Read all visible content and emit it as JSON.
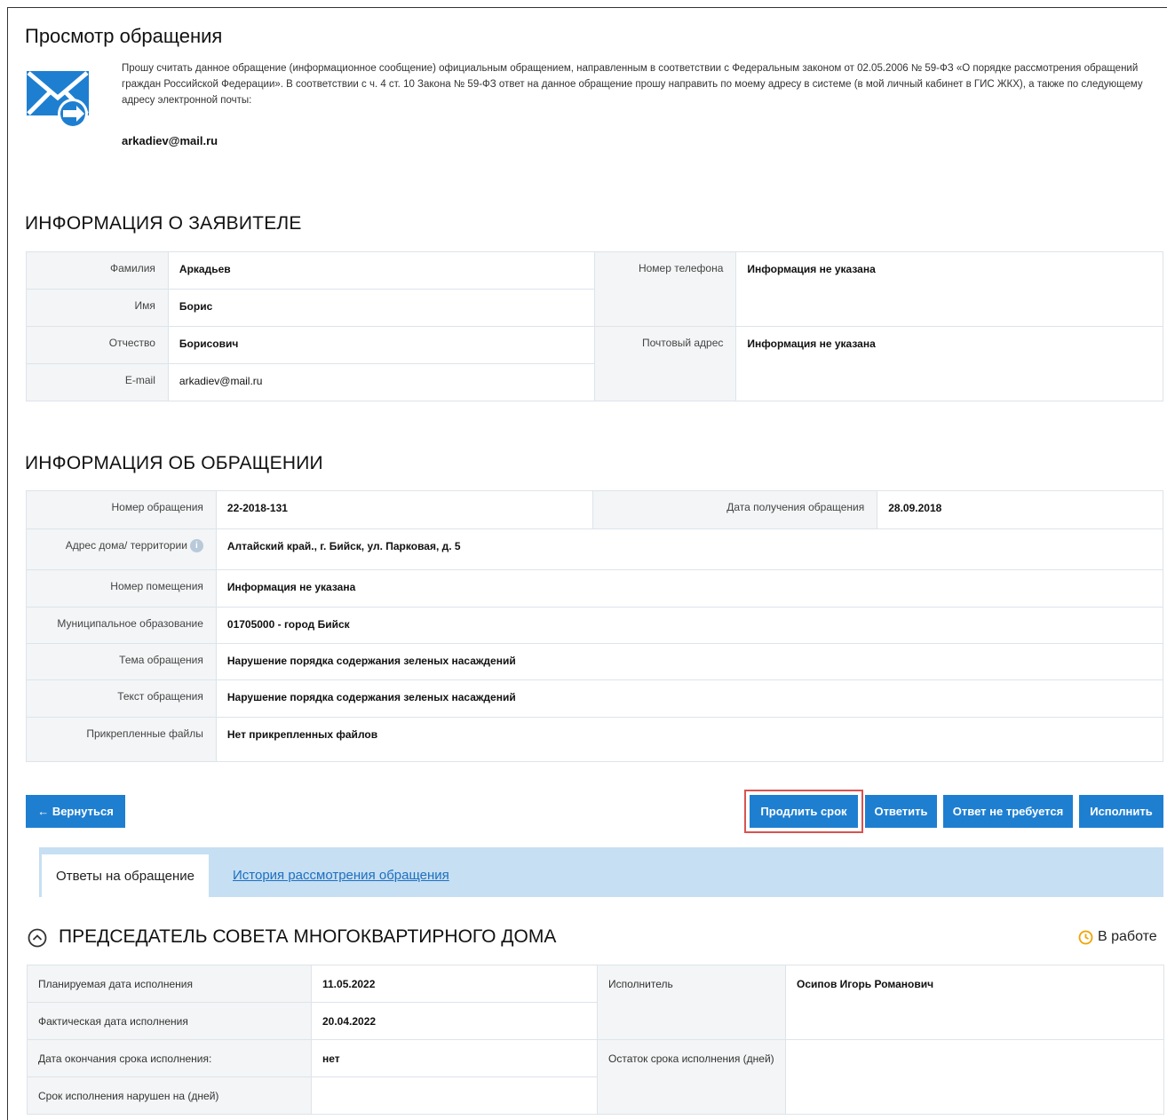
{
  "page": {
    "title": "Просмотр обращения",
    "intro_text": "Прошу считать данное обращение (информационное сообщение) официальным обращением, направленным в соответствии с Федеральным законом от 02.05.2006 № 59-ФЗ «О порядке рассмотрения обращений граждан Российской Федерации». В соответствии с ч. 4 ст. 10 Закона № 59-ФЗ ответ на данное обращение прошу направить по моему адресу в системе (в мой личный кабинет в ГИС ЖКХ), а также по следующему адресу электронной почты:",
    "intro_email": "arkadiev@mail.ru"
  },
  "applicant": {
    "section_title": "ИНФОРМАЦИЯ О ЗАЯВИТЕЛЕ",
    "surname_label": "Фамилия",
    "surname": "Аркадьев",
    "name_label": "Имя",
    "name": "Борис",
    "patronymic_label": "Отчество",
    "patronymic": "Борисович",
    "email_label": "E-mail",
    "email": "arkadiev@mail.ru",
    "phone_label": "Номер телефона",
    "phone": "Информация не указана",
    "postal_label": "Почтовый адрес",
    "postal": "Информация не указана"
  },
  "appeal": {
    "section_title": "ИНФОРМАЦИЯ ОБ ОБРАЩЕНИИ",
    "number_label": "Номер обращения",
    "number": "22-2018-131",
    "date_label": "Дата получения обращения",
    "date": "28.09.2018",
    "address_label": "Адрес дома/ территории",
    "address": "Алтайский край., г. Бийск, ул. Парковая, д. 5",
    "room_label": "Номер помещения",
    "room": "Информация не указана",
    "municipality_label": "Муниципальное образование",
    "municipality": "01705000 - город Бийск",
    "topic_label": "Тема обращения",
    "topic": "Нарушение порядка содержания зеленых насаждений",
    "text_label": "Текст обращения",
    "text": "Нарушение порядка содержания зеленых насаждений",
    "files_label": "Прикрепленные файлы",
    "files": "Нет прикрепленных файлов"
  },
  "actions": {
    "back": "← Вернуться",
    "extend": "Продлить срок",
    "reply": "Ответить",
    "no_reply": "Ответ не требуется",
    "execute": "Исполнить"
  },
  "tabs": {
    "responses": "Ответы на обращение",
    "history": "История рассмотрения обращения"
  },
  "response": {
    "title": "ПРЕДСЕДАТЕЛЬ СОВЕТА МНОГОКВАРТИРНОГО ДОМА",
    "status": "В работе",
    "planned_label": "Планируемая дата исполнения",
    "planned": "11.05.2022",
    "actual_label": "Фактическая дата исполнения",
    "actual": "20.04.2022",
    "end_label": "Дата окончания срока исполнения:",
    "end": "нет",
    "violated_label": "Срок исполнения нарушен на (дней)",
    "violated": "",
    "executor_label": "Исполнитель",
    "executor": "Осипов Игорь Романович",
    "remaining_label": "Остаток срока исполнения (дней)",
    "remaining": ""
  },
  "colors": {
    "primary_button": "#1e7fd1",
    "highlight_border": "#d9534f",
    "tab_bar": "#c6dff2",
    "status_icon": "#f0a500",
    "envelope_icon": "#1e7fd1"
  }
}
